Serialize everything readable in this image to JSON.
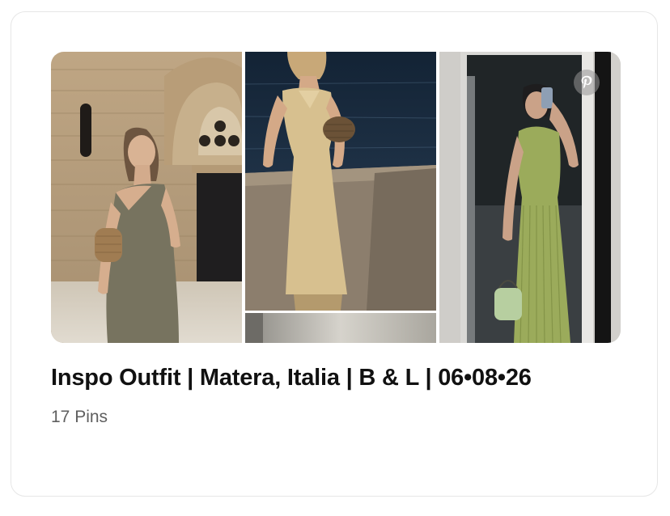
{
  "board": {
    "title": "Inspo Outfit | Matera, Italia | B & L | 06•08•26",
    "pin_count": "17 Pins"
  },
  "collage": {
    "tiles": [
      {
        "subject": "woman in olive one-shoulder dress by stone church"
      },
      {
        "subject": "woman in beige halter dress by the sea"
      },
      {
        "subject": "partial image"
      },
      {
        "subject": "woman in green pleated halter dress taking mirror selfie"
      }
    ]
  },
  "icons": {
    "badge": "pinterest-logo-icon"
  }
}
